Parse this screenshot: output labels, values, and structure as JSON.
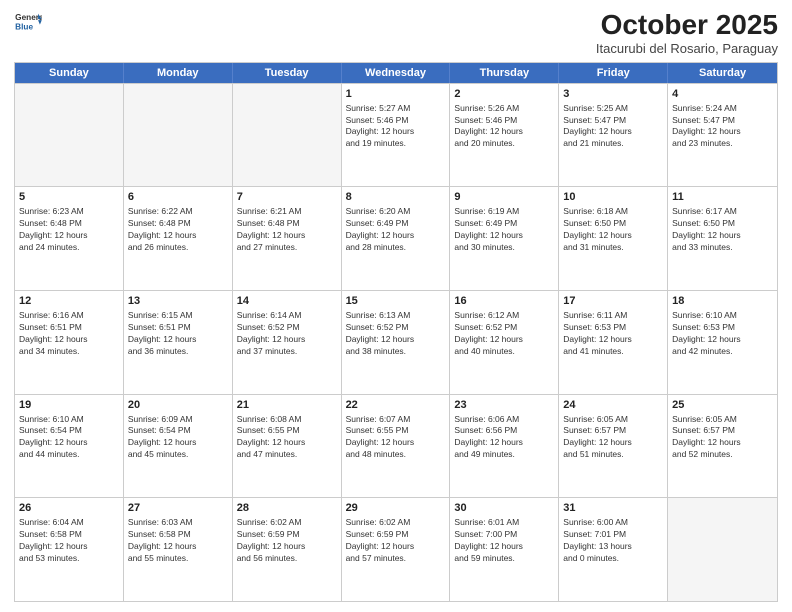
{
  "header": {
    "logo_general": "General",
    "logo_blue": "Blue",
    "month_title": "October 2025",
    "location": "Itacurubi del Rosario, Paraguay"
  },
  "days_of_week": [
    "Sunday",
    "Monday",
    "Tuesday",
    "Wednesday",
    "Thursday",
    "Friday",
    "Saturday"
  ],
  "weeks": [
    [
      {
        "day": "",
        "info": "",
        "empty": true
      },
      {
        "day": "",
        "info": "",
        "empty": true
      },
      {
        "day": "",
        "info": "",
        "empty": true
      },
      {
        "day": "1",
        "info": "Sunrise: 5:27 AM\nSunset: 5:46 PM\nDaylight: 12 hours\nand 19 minutes."
      },
      {
        "day": "2",
        "info": "Sunrise: 5:26 AM\nSunset: 5:46 PM\nDaylight: 12 hours\nand 20 minutes."
      },
      {
        "day": "3",
        "info": "Sunrise: 5:25 AM\nSunset: 5:47 PM\nDaylight: 12 hours\nand 21 minutes."
      },
      {
        "day": "4",
        "info": "Sunrise: 5:24 AM\nSunset: 5:47 PM\nDaylight: 12 hours\nand 23 minutes."
      }
    ],
    [
      {
        "day": "5",
        "info": "Sunrise: 6:23 AM\nSunset: 6:48 PM\nDaylight: 12 hours\nand 24 minutes."
      },
      {
        "day": "6",
        "info": "Sunrise: 6:22 AM\nSunset: 6:48 PM\nDaylight: 12 hours\nand 26 minutes."
      },
      {
        "day": "7",
        "info": "Sunrise: 6:21 AM\nSunset: 6:48 PM\nDaylight: 12 hours\nand 27 minutes."
      },
      {
        "day": "8",
        "info": "Sunrise: 6:20 AM\nSunset: 6:49 PM\nDaylight: 12 hours\nand 28 minutes."
      },
      {
        "day": "9",
        "info": "Sunrise: 6:19 AM\nSunset: 6:49 PM\nDaylight: 12 hours\nand 30 minutes."
      },
      {
        "day": "10",
        "info": "Sunrise: 6:18 AM\nSunset: 6:50 PM\nDaylight: 12 hours\nand 31 minutes."
      },
      {
        "day": "11",
        "info": "Sunrise: 6:17 AM\nSunset: 6:50 PM\nDaylight: 12 hours\nand 33 minutes."
      }
    ],
    [
      {
        "day": "12",
        "info": "Sunrise: 6:16 AM\nSunset: 6:51 PM\nDaylight: 12 hours\nand 34 minutes."
      },
      {
        "day": "13",
        "info": "Sunrise: 6:15 AM\nSunset: 6:51 PM\nDaylight: 12 hours\nand 36 minutes."
      },
      {
        "day": "14",
        "info": "Sunrise: 6:14 AM\nSunset: 6:52 PM\nDaylight: 12 hours\nand 37 minutes."
      },
      {
        "day": "15",
        "info": "Sunrise: 6:13 AM\nSunset: 6:52 PM\nDaylight: 12 hours\nand 38 minutes."
      },
      {
        "day": "16",
        "info": "Sunrise: 6:12 AM\nSunset: 6:52 PM\nDaylight: 12 hours\nand 40 minutes."
      },
      {
        "day": "17",
        "info": "Sunrise: 6:11 AM\nSunset: 6:53 PM\nDaylight: 12 hours\nand 41 minutes."
      },
      {
        "day": "18",
        "info": "Sunrise: 6:10 AM\nSunset: 6:53 PM\nDaylight: 12 hours\nand 42 minutes."
      }
    ],
    [
      {
        "day": "19",
        "info": "Sunrise: 6:10 AM\nSunset: 6:54 PM\nDaylight: 12 hours\nand 44 minutes."
      },
      {
        "day": "20",
        "info": "Sunrise: 6:09 AM\nSunset: 6:54 PM\nDaylight: 12 hours\nand 45 minutes."
      },
      {
        "day": "21",
        "info": "Sunrise: 6:08 AM\nSunset: 6:55 PM\nDaylight: 12 hours\nand 47 minutes."
      },
      {
        "day": "22",
        "info": "Sunrise: 6:07 AM\nSunset: 6:55 PM\nDaylight: 12 hours\nand 48 minutes."
      },
      {
        "day": "23",
        "info": "Sunrise: 6:06 AM\nSunset: 6:56 PM\nDaylight: 12 hours\nand 49 minutes."
      },
      {
        "day": "24",
        "info": "Sunrise: 6:05 AM\nSunset: 6:57 PM\nDaylight: 12 hours\nand 51 minutes."
      },
      {
        "day": "25",
        "info": "Sunrise: 6:05 AM\nSunset: 6:57 PM\nDaylight: 12 hours\nand 52 minutes."
      }
    ],
    [
      {
        "day": "26",
        "info": "Sunrise: 6:04 AM\nSunset: 6:58 PM\nDaylight: 12 hours\nand 53 minutes."
      },
      {
        "day": "27",
        "info": "Sunrise: 6:03 AM\nSunset: 6:58 PM\nDaylight: 12 hours\nand 55 minutes."
      },
      {
        "day": "28",
        "info": "Sunrise: 6:02 AM\nSunset: 6:59 PM\nDaylight: 12 hours\nand 56 minutes."
      },
      {
        "day": "29",
        "info": "Sunrise: 6:02 AM\nSunset: 6:59 PM\nDaylight: 12 hours\nand 57 minutes."
      },
      {
        "day": "30",
        "info": "Sunrise: 6:01 AM\nSunset: 7:00 PM\nDaylight: 12 hours\nand 59 minutes."
      },
      {
        "day": "31",
        "info": "Sunrise: 6:00 AM\nSunset: 7:01 PM\nDaylight: 13 hours\nand 0 minutes."
      },
      {
        "day": "",
        "info": "",
        "empty": true
      }
    ]
  ]
}
